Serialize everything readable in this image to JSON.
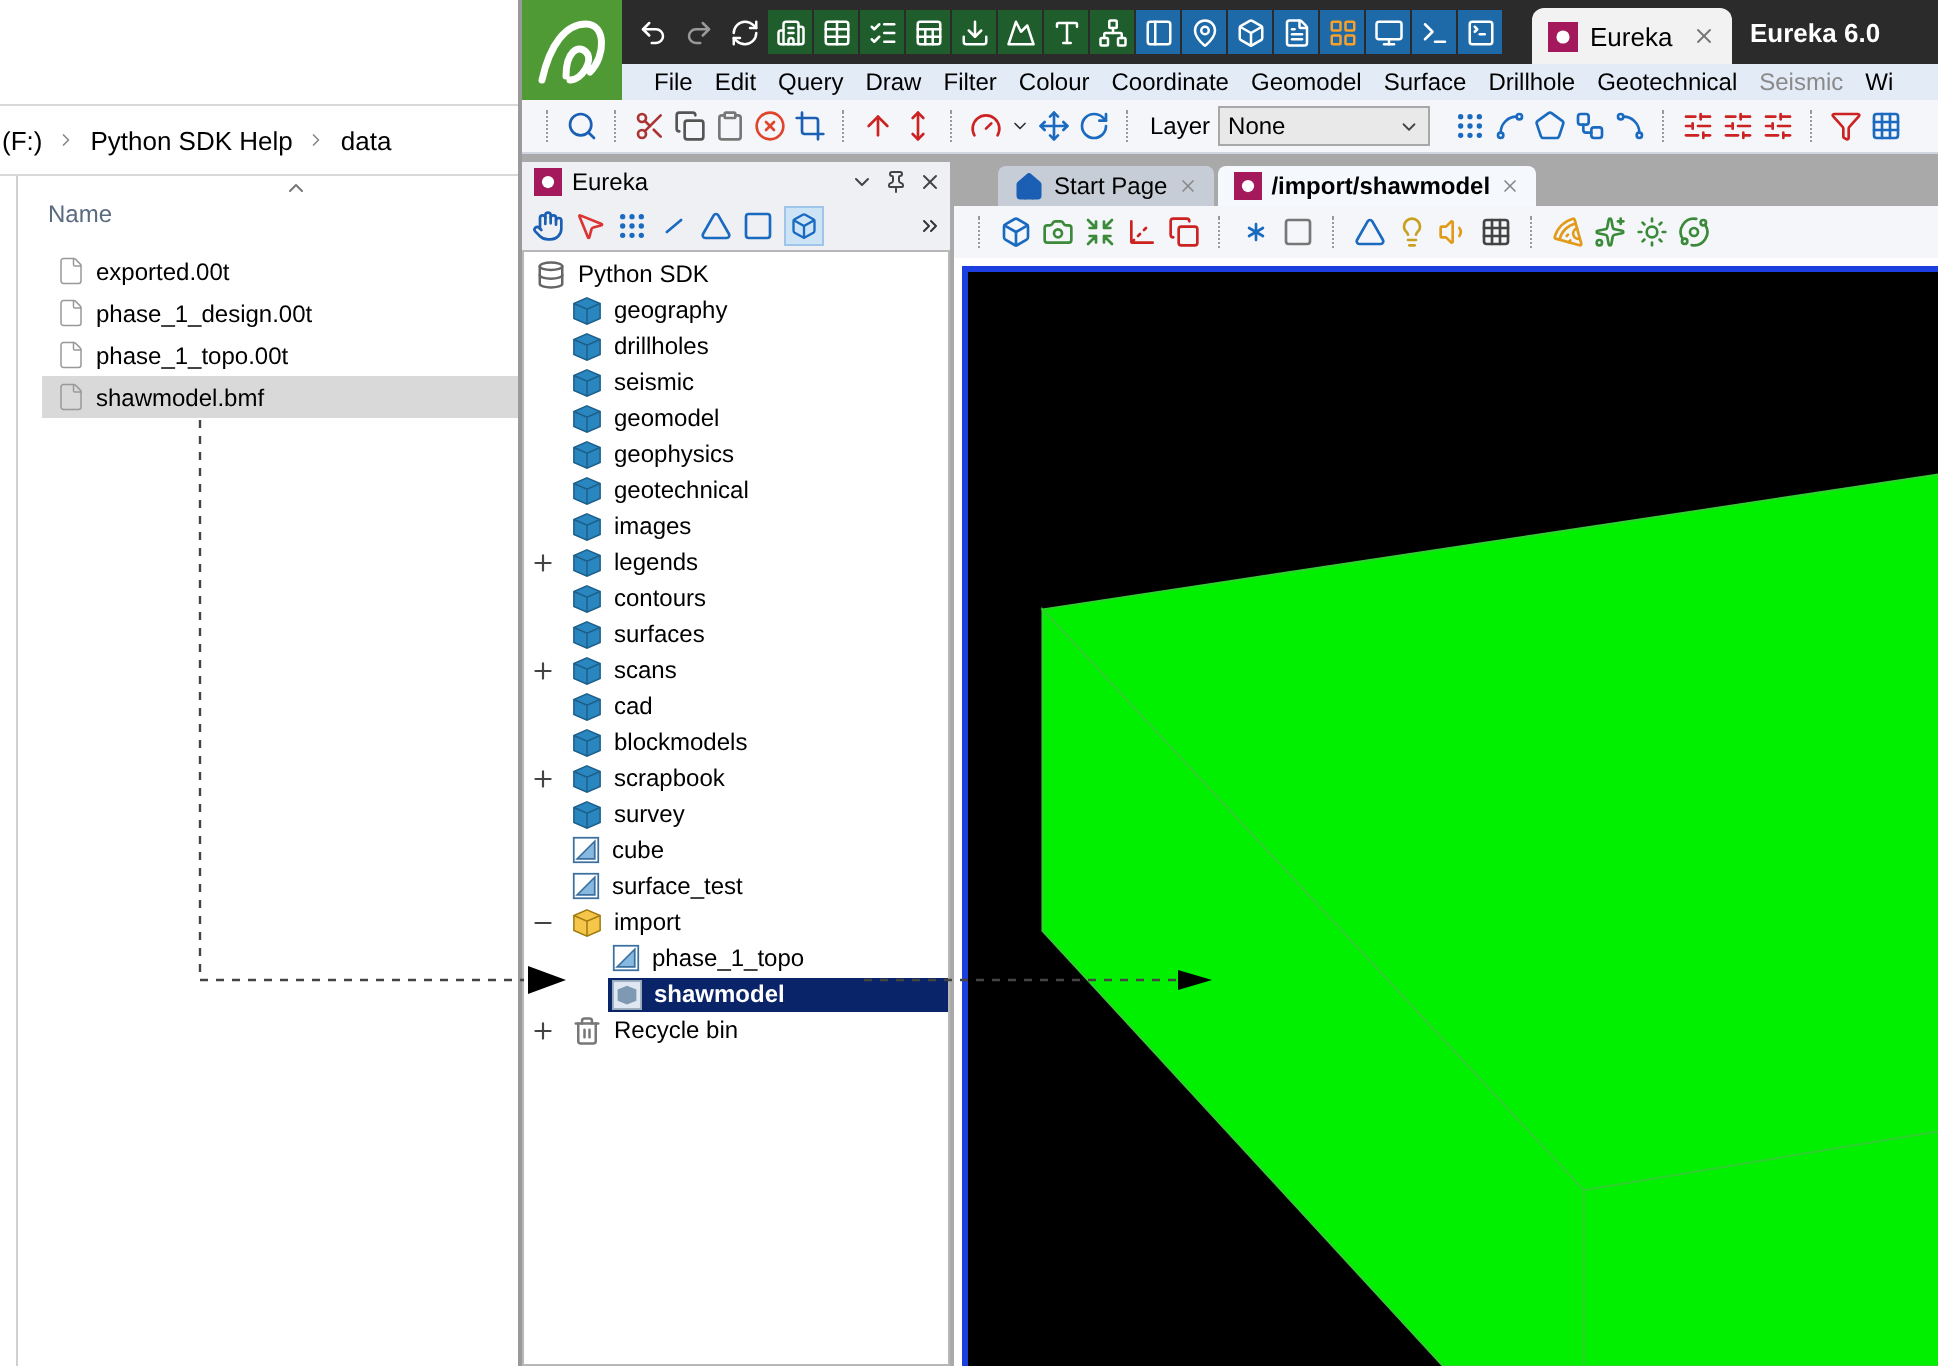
{
  "explorer": {
    "breadcrumb": [
      "(F:)",
      "Python SDK Help",
      "data"
    ],
    "column": "Name",
    "files": [
      {
        "name": "exported.00t",
        "selected": false
      },
      {
        "name": "phase_1_design.00t",
        "selected": false
      },
      {
        "name": "phase_1_topo.00t",
        "selected": false
      },
      {
        "name": "shawmodel.bmf",
        "selected": true
      }
    ]
  },
  "app": {
    "tab": {
      "label": "Eureka",
      "selected": true
    },
    "title": "Eureka 6.0",
    "menu": [
      {
        "label": "File",
        "disabled": false
      },
      {
        "label": "Edit",
        "disabled": false
      },
      {
        "label": "Query",
        "disabled": false
      },
      {
        "label": "Draw",
        "disabled": false
      },
      {
        "label": "Filter",
        "disabled": false
      },
      {
        "label": "Colour",
        "disabled": false
      },
      {
        "label": "Coordinate",
        "disabled": false
      },
      {
        "label": "Geomodel",
        "disabled": false
      },
      {
        "label": "Surface",
        "disabled": false
      },
      {
        "label": "Drillhole",
        "disabled": false
      },
      {
        "label": "Geotechnical",
        "disabled": false
      },
      {
        "label": "Seismic",
        "disabled": true
      },
      {
        "label": "Wi",
        "disabled": false
      }
    ],
    "layer": {
      "label": "Layer",
      "value": "None"
    }
  },
  "panel": {
    "title": "Eureka",
    "tree": [
      {
        "label": "Python SDK",
        "kind": "database",
        "selected": false,
        "children": [
          {
            "label": "geography",
            "kind": "folder",
            "selected": false
          },
          {
            "label": "drillholes",
            "kind": "folder",
            "selected": false
          },
          {
            "label": "seismic",
            "kind": "folder",
            "selected": false
          },
          {
            "label": "geomodel",
            "kind": "folder",
            "selected": false
          },
          {
            "label": "geophysics",
            "kind": "folder",
            "selected": false
          },
          {
            "label": "geotechnical",
            "kind": "folder",
            "selected": false
          },
          {
            "label": "images",
            "kind": "folder",
            "selected": false
          },
          {
            "label": "legends",
            "kind": "folder",
            "selected": false,
            "expanded": false
          },
          {
            "label": "contours",
            "kind": "folder",
            "selected": false
          },
          {
            "label": "surfaces",
            "kind": "folder",
            "selected": false
          },
          {
            "label": "scans",
            "kind": "folder",
            "selected": false,
            "expanded": false
          },
          {
            "label": "cad",
            "kind": "folder",
            "selected": false
          },
          {
            "label": "blockmodels",
            "kind": "folder",
            "selected": false
          },
          {
            "label": "scrapbook",
            "kind": "folder",
            "selected": false,
            "expanded": false
          },
          {
            "label": "survey",
            "kind": "folder",
            "selected": false
          },
          {
            "label": "cube",
            "kind": "surface",
            "selected": false
          },
          {
            "label": "surface_test",
            "kind": "surface",
            "selected": false
          },
          {
            "label": "import",
            "kind": "import",
            "selected": false,
            "expanded": true,
            "children": [
              {
                "label": "phase_1_topo",
                "kind": "surface",
                "selected": false
              },
              {
                "label": "shawmodel",
                "kind": "blockmodel",
                "selected": true
              }
            ]
          },
          {
            "label": "Recycle bin",
            "kind": "recycle",
            "selected": false,
            "expanded": false
          }
        ]
      }
    ]
  },
  "viewer": {
    "tabs": [
      {
        "label": "Start Page",
        "kind": "home",
        "selected": false
      },
      {
        "label": "/import/shawmodel",
        "kind": "model",
        "selected": true
      }
    ]
  }
}
